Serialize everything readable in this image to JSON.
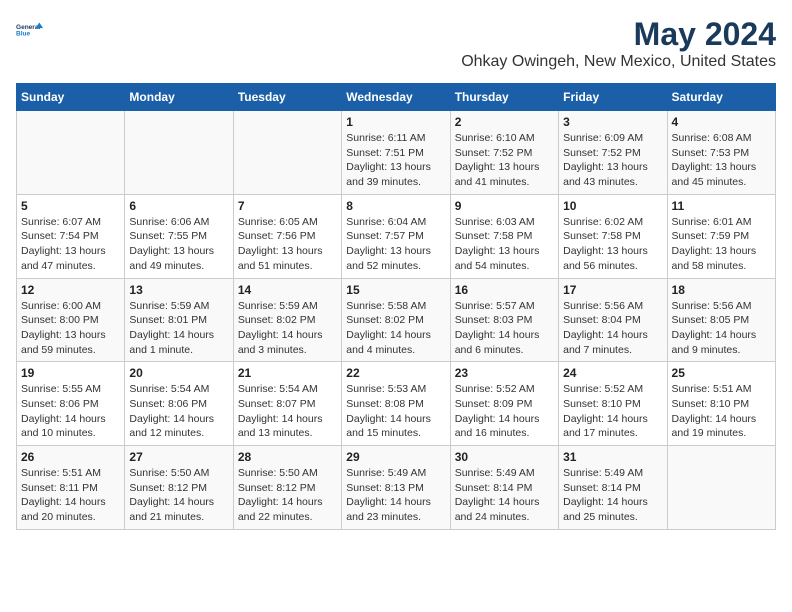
{
  "header": {
    "logo_line1": "General",
    "logo_line2": "Blue",
    "title": "May 2024",
    "subtitle": "Ohkay Owingeh, New Mexico, United States"
  },
  "weekdays": [
    "Sunday",
    "Monday",
    "Tuesday",
    "Wednesday",
    "Thursday",
    "Friday",
    "Saturday"
  ],
  "weeks": [
    [
      {
        "day": "",
        "info": ""
      },
      {
        "day": "",
        "info": ""
      },
      {
        "day": "",
        "info": ""
      },
      {
        "day": "1",
        "info": "Sunrise: 6:11 AM\nSunset: 7:51 PM\nDaylight: 13 hours\nand 39 minutes."
      },
      {
        "day": "2",
        "info": "Sunrise: 6:10 AM\nSunset: 7:52 PM\nDaylight: 13 hours\nand 41 minutes."
      },
      {
        "day": "3",
        "info": "Sunrise: 6:09 AM\nSunset: 7:52 PM\nDaylight: 13 hours\nand 43 minutes."
      },
      {
        "day": "4",
        "info": "Sunrise: 6:08 AM\nSunset: 7:53 PM\nDaylight: 13 hours\nand 45 minutes."
      }
    ],
    [
      {
        "day": "5",
        "info": "Sunrise: 6:07 AM\nSunset: 7:54 PM\nDaylight: 13 hours\nand 47 minutes."
      },
      {
        "day": "6",
        "info": "Sunrise: 6:06 AM\nSunset: 7:55 PM\nDaylight: 13 hours\nand 49 minutes."
      },
      {
        "day": "7",
        "info": "Sunrise: 6:05 AM\nSunset: 7:56 PM\nDaylight: 13 hours\nand 51 minutes."
      },
      {
        "day": "8",
        "info": "Sunrise: 6:04 AM\nSunset: 7:57 PM\nDaylight: 13 hours\nand 52 minutes."
      },
      {
        "day": "9",
        "info": "Sunrise: 6:03 AM\nSunset: 7:58 PM\nDaylight: 13 hours\nand 54 minutes."
      },
      {
        "day": "10",
        "info": "Sunrise: 6:02 AM\nSunset: 7:58 PM\nDaylight: 13 hours\nand 56 minutes."
      },
      {
        "day": "11",
        "info": "Sunrise: 6:01 AM\nSunset: 7:59 PM\nDaylight: 13 hours\nand 58 minutes."
      }
    ],
    [
      {
        "day": "12",
        "info": "Sunrise: 6:00 AM\nSunset: 8:00 PM\nDaylight: 13 hours\nand 59 minutes."
      },
      {
        "day": "13",
        "info": "Sunrise: 5:59 AM\nSunset: 8:01 PM\nDaylight: 14 hours\nand 1 minute."
      },
      {
        "day": "14",
        "info": "Sunrise: 5:59 AM\nSunset: 8:02 PM\nDaylight: 14 hours\nand 3 minutes."
      },
      {
        "day": "15",
        "info": "Sunrise: 5:58 AM\nSunset: 8:02 PM\nDaylight: 14 hours\nand 4 minutes."
      },
      {
        "day": "16",
        "info": "Sunrise: 5:57 AM\nSunset: 8:03 PM\nDaylight: 14 hours\nand 6 minutes."
      },
      {
        "day": "17",
        "info": "Sunrise: 5:56 AM\nSunset: 8:04 PM\nDaylight: 14 hours\nand 7 minutes."
      },
      {
        "day": "18",
        "info": "Sunrise: 5:56 AM\nSunset: 8:05 PM\nDaylight: 14 hours\nand 9 minutes."
      }
    ],
    [
      {
        "day": "19",
        "info": "Sunrise: 5:55 AM\nSunset: 8:06 PM\nDaylight: 14 hours\nand 10 minutes."
      },
      {
        "day": "20",
        "info": "Sunrise: 5:54 AM\nSunset: 8:06 PM\nDaylight: 14 hours\nand 12 minutes."
      },
      {
        "day": "21",
        "info": "Sunrise: 5:54 AM\nSunset: 8:07 PM\nDaylight: 14 hours\nand 13 minutes."
      },
      {
        "day": "22",
        "info": "Sunrise: 5:53 AM\nSunset: 8:08 PM\nDaylight: 14 hours\nand 15 minutes."
      },
      {
        "day": "23",
        "info": "Sunrise: 5:52 AM\nSunset: 8:09 PM\nDaylight: 14 hours\nand 16 minutes."
      },
      {
        "day": "24",
        "info": "Sunrise: 5:52 AM\nSunset: 8:10 PM\nDaylight: 14 hours\nand 17 minutes."
      },
      {
        "day": "25",
        "info": "Sunrise: 5:51 AM\nSunset: 8:10 PM\nDaylight: 14 hours\nand 19 minutes."
      }
    ],
    [
      {
        "day": "26",
        "info": "Sunrise: 5:51 AM\nSunset: 8:11 PM\nDaylight: 14 hours\nand 20 minutes."
      },
      {
        "day": "27",
        "info": "Sunrise: 5:50 AM\nSunset: 8:12 PM\nDaylight: 14 hours\nand 21 minutes."
      },
      {
        "day": "28",
        "info": "Sunrise: 5:50 AM\nSunset: 8:12 PM\nDaylight: 14 hours\nand 22 minutes."
      },
      {
        "day": "29",
        "info": "Sunrise: 5:49 AM\nSunset: 8:13 PM\nDaylight: 14 hours\nand 23 minutes."
      },
      {
        "day": "30",
        "info": "Sunrise: 5:49 AM\nSunset: 8:14 PM\nDaylight: 14 hours\nand 24 minutes."
      },
      {
        "day": "31",
        "info": "Sunrise: 5:49 AM\nSunset: 8:14 PM\nDaylight: 14 hours\nand 25 minutes."
      },
      {
        "day": "",
        "info": ""
      }
    ]
  ]
}
